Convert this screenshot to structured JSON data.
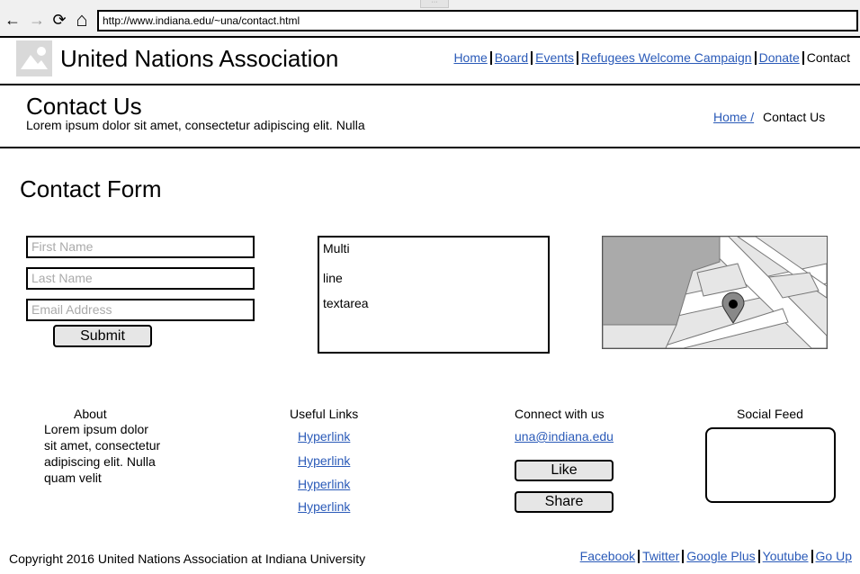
{
  "browser": {
    "url": "http://www.indiana.edu/~una/contact.html",
    "back_glyph": "←",
    "forward_glyph": "→",
    "reload_glyph": "⟳",
    "home_glyph": "⌂"
  },
  "header": {
    "title": "United Nations Association",
    "logo_icon": "image-placeholder-icon",
    "nav": [
      "Home",
      "Board",
      "Events",
      "Refugees Welcome Campaign",
      "Donate",
      "Contact"
    ]
  },
  "page": {
    "title": "Contact Us",
    "subtitle": "Lorem ipsum dolor sit amet, consectetur adipiscing elit. Nulla",
    "breadcrumb": {
      "home": "Home /",
      "current": "Contact Us"
    }
  },
  "form": {
    "title": "Contact Form",
    "first_name_placeholder": "First Name",
    "last_name_placeholder": "Last Name",
    "email_placeholder": "Email Address",
    "submit_label": "Submit",
    "textarea_lines": [
      "Multi",
      "line",
      "textarea"
    ]
  },
  "map": {
    "icon": "map-pin-icon"
  },
  "footer": {
    "about": {
      "heading": "About",
      "text": "Lorem ipsum dolor sit amet, consectetur adipiscing elit. Nulla quam velit"
    },
    "links": {
      "heading": "Useful Links",
      "items": [
        "Hyperlink",
        "Hyperlink",
        "Hyperlink",
        "Hyperlink"
      ]
    },
    "connect": {
      "heading": "Connect with us",
      "email": "una@indiana.edu",
      "like_label": "Like",
      "share_label": "Share"
    },
    "social": {
      "heading": "Social Feed"
    },
    "copyright": "Copyright 2016 United Nations Association at Indiana University",
    "nav": [
      "Facebook",
      "Twitter",
      "Google Plus",
      "Youtube",
      "Go Up"
    ]
  },
  "colors": {
    "link": "#2a5ab8",
    "button_bg": "#e6e6e6",
    "chrome_bg": "#f0f0f0"
  }
}
